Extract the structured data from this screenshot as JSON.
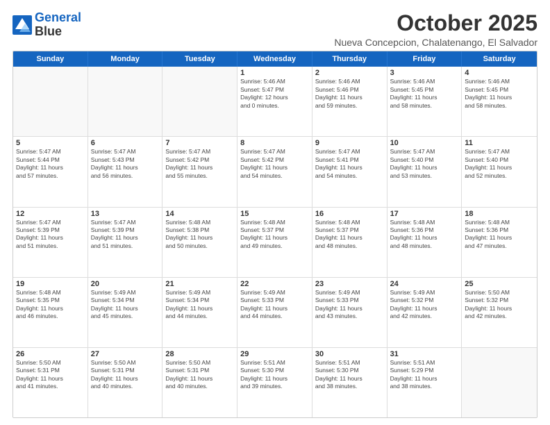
{
  "logo": {
    "line1": "General",
    "line2": "Blue"
  },
  "title": "October 2025",
  "subtitle": "Nueva Concepcion, Chalatenango, El Salvador",
  "header_days": [
    "Sunday",
    "Monday",
    "Tuesday",
    "Wednesday",
    "Thursday",
    "Friday",
    "Saturday"
  ],
  "weeks": [
    [
      {
        "day": "",
        "info": ""
      },
      {
        "day": "",
        "info": ""
      },
      {
        "day": "",
        "info": ""
      },
      {
        "day": "1",
        "info": "Sunrise: 5:46 AM\nSunset: 5:47 PM\nDaylight: 12 hours\nand 0 minutes."
      },
      {
        "day": "2",
        "info": "Sunrise: 5:46 AM\nSunset: 5:46 PM\nDaylight: 11 hours\nand 59 minutes."
      },
      {
        "day": "3",
        "info": "Sunrise: 5:46 AM\nSunset: 5:45 PM\nDaylight: 11 hours\nand 58 minutes."
      },
      {
        "day": "4",
        "info": "Sunrise: 5:46 AM\nSunset: 5:45 PM\nDaylight: 11 hours\nand 58 minutes."
      }
    ],
    [
      {
        "day": "5",
        "info": "Sunrise: 5:47 AM\nSunset: 5:44 PM\nDaylight: 11 hours\nand 57 minutes."
      },
      {
        "day": "6",
        "info": "Sunrise: 5:47 AM\nSunset: 5:43 PM\nDaylight: 11 hours\nand 56 minutes."
      },
      {
        "day": "7",
        "info": "Sunrise: 5:47 AM\nSunset: 5:42 PM\nDaylight: 11 hours\nand 55 minutes."
      },
      {
        "day": "8",
        "info": "Sunrise: 5:47 AM\nSunset: 5:42 PM\nDaylight: 11 hours\nand 54 minutes."
      },
      {
        "day": "9",
        "info": "Sunrise: 5:47 AM\nSunset: 5:41 PM\nDaylight: 11 hours\nand 54 minutes."
      },
      {
        "day": "10",
        "info": "Sunrise: 5:47 AM\nSunset: 5:40 PM\nDaylight: 11 hours\nand 53 minutes."
      },
      {
        "day": "11",
        "info": "Sunrise: 5:47 AM\nSunset: 5:40 PM\nDaylight: 11 hours\nand 52 minutes."
      }
    ],
    [
      {
        "day": "12",
        "info": "Sunrise: 5:47 AM\nSunset: 5:39 PM\nDaylight: 11 hours\nand 51 minutes."
      },
      {
        "day": "13",
        "info": "Sunrise: 5:47 AM\nSunset: 5:39 PM\nDaylight: 11 hours\nand 51 minutes."
      },
      {
        "day": "14",
        "info": "Sunrise: 5:48 AM\nSunset: 5:38 PM\nDaylight: 11 hours\nand 50 minutes."
      },
      {
        "day": "15",
        "info": "Sunrise: 5:48 AM\nSunset: 5:37 PM\nDaylight: 11 hours\nand 49 minutes."
      },
      {
        "day": "16",
        "info": "Sunrise: 5:48 AM\nSunset: 5:37 PM\nDaylight: 11 hours\nand 48 minutes."
      },
      {
        "day": "17",
        "info": "Sunrise: 5:48 AM\nSunset: 5:36 PM\nDaylight: 11 hours\nand 48 minutes."
      },
      {
        "day": "18",
        "info": "Sunrise: 5:48 AM\nSunset: 5:36 PM\nDaylight: 11 hours\nand 47 minutes."
      }
    ],
    [
      {
        "day": "19",
        "info": "Sunrise: 5:48 AM\nSunset: 5:35 PM\nDaylight: 11 hours\nand 46 minutes."
      },
      {
        "day": "20",
        "info": "Sunrise: 5:49 AM\nSunset: 5:34 PM\nDaylight: 11 hours\nand 45 minutes."
      },
      {
        "day": "21",
        "info": "Sunrise: 5:49 AM\nSunset: 5:34 PM\nDaylight: 11 hours\nand 44 minutes."
      },
      {
        "day": "22",
        "info": "Sunrise: 5:49 AM\nSunset: 5:33 PM\nDaylight: 11 hours\nand 44 minutes."
      },
      {
        "day": "23",
        "info": "Sunrise: 5:49 AM\nSunset: 5:33 PM\nDaylight: 11 hours\nand 43 minutes."
      },
      {
        "day": "24",
        "info": "Sunrise: 5:49 AM\nSunset: 5:32 PM\nDaylight: 11 hours\nand 42 minutes."
      },
      {
        "day": "25",
        "info": "Sunrise: 5:50 AM\nSunset: 5:32 PM\nDaylight: 11 hours\nand 42 minutes."
      }
    ],
    [
      {
        "day": "26",
        "info": "Sunrise: 5:50 AM\nSunset: 5:31 PM\nDaylight: 11 hours\nand 41 minutes."
      },
      {
        "day": "27",
        "info": "Sunrise: 5:50 AM\nSunset: 5:31 PM\nDaylight: 11 hours\nand 40 minutes."
      },
      {
        "day": "28",
        "info": "Sunrise: 5:50 AM\nSunset: 5:31 PM\nDaylight: 11 hours\nand 40 minutes."
      },
      {
        "day": "29",
        "info": "Sunrise: 5:51 AM\nSunset: 5:30 PM\nDaylight: 11 hours\nand 39 minutes."
      },
      {
        "day": "30",
        "info": "Sunrise: 5:51 AM\nSunset: 5:30 PM\nDaylight: 11 hours\nand 38 minutes."
      },
      {
        "day": "31",
        "info": "Sunrise: 5:51 AM\nSunset: 5:29 PM\nDaylight: 11 hours\nand 38 minutes."
      },
      {
        "day": "",
        "info": ""
      }
    ]
  ]
}
